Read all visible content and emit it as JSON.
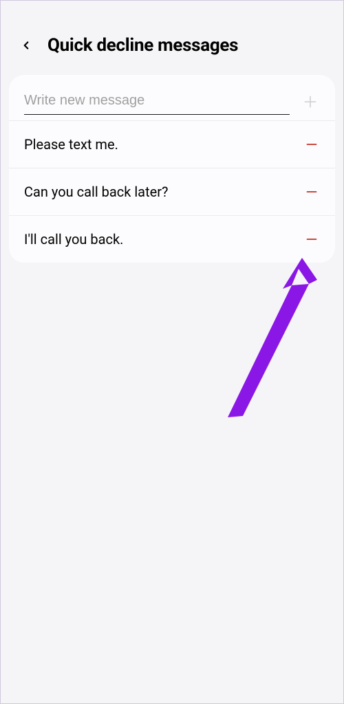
{
  "header": {
    "title": "Quick decline messages"
  },
  "input": {
    "placeholder": "Write new message",
    "value": ""
  },
  "messages": [
    {
      "text": "Please text me."
    },
    {
      "text": "Can you call back later?"
    },
    {
      "text": "I'll call you back."
    }
  ],
  "colors": {
    "remove_icon": "#c94a3c",
    "arrow": "#8a17e6"
  }
}
